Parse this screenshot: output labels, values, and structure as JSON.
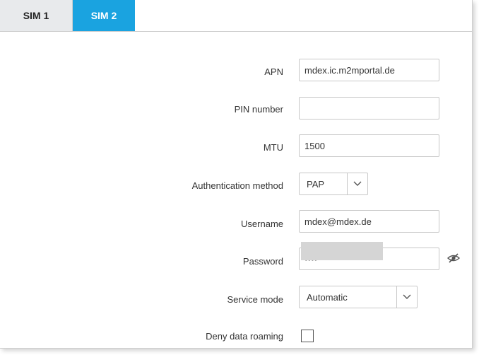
{
  "tabs": [
    {
      "label": "SIM 1",
      "active": false
    },
    {
      "label": "SIM 2",
      "active": true
    }
  ],
  "form": {
    "apn": {
      "label": "APN",
      "value": "mdex.ic.m2mportal.de"
    },
    "pin": {
      "label": "PIN number",
      "value": ""
    },
    "mtu": {
      "label": "MTU",
      "value": "1500"
    },
    "auth": {
      "label": "Authentication method",
      "value": "PAP"
    },
    "username": {
      "label": "Username",
      "value": "mdex@mdex.de"
    },
    "password": {
      "label": "Password",
      "value": "••••",
      "icon": "eye-slash-icon"
    },
    "service_mode": {
      "label": "Service mode",
      "value": "Automatic"
    },
    "deny_roaming": {
      "label": "Deny data roaming",
      "checked": false
    }
  },
  "colors": {
    "active_tab": "#1aa3e0",
    "inactive_tab": "#e8eaec"
  }
}
